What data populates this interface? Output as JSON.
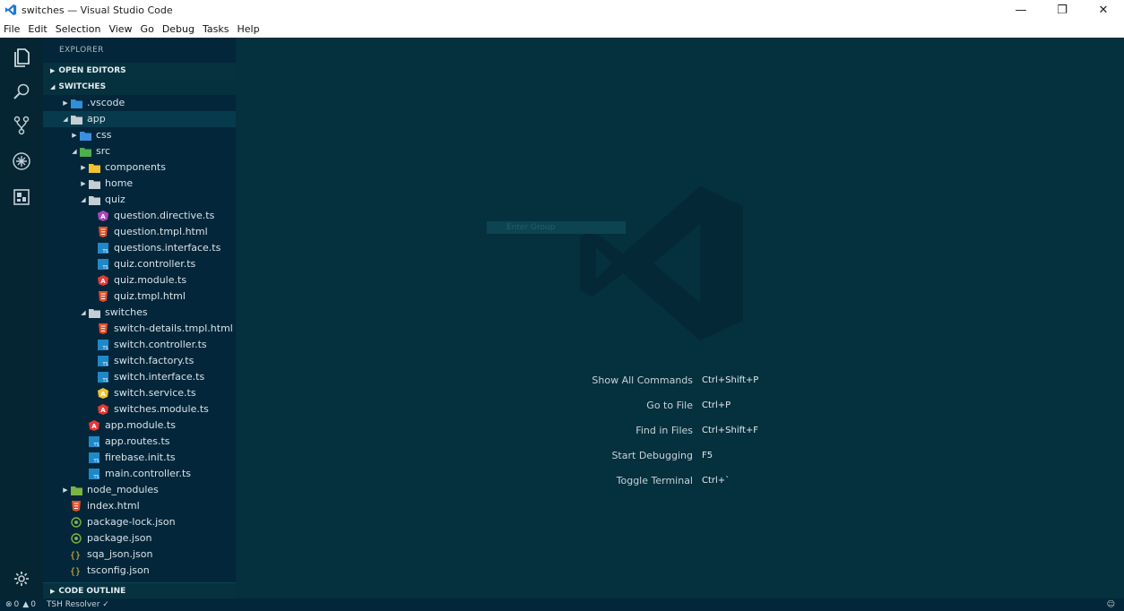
{
  "window": {
    "title": "switches — Visual Studio Code"
  },
  "menu": [
    "File",
    "Edit",
    "Selection",
    "View",
    "Go",
    "Debug",
    "Tasks",
    "Help"
  ],
  "window_controls": {
    "minimize": "—",
    "maximize": "❐",
    "close": "✕"
  },
  "explorer": {
    "title": "EXPLORER",
    "open_editors": "OPEN EDITORS",
    "folder": "SWITCHES",
    "code_outline": "CODE OUTLINE",
    "tree": [
      {
        "label": ".vscode",
        "depth": 1,
        "type": "folder",
        "arrow": "▶",
        "icon": "vscode-folder-icon",
        "color": "#2f8fd8"
      },
      {
        "label": "app",
        "depth": 1,
        "type": "folder",
        "arrow": "◢",
        "icon": "folder-open-icon",
        "color": "#c5ced3",
        "selected": true
      },
      {
        "label": "css",
        "depth": 2,
        "type": "folder",
        "arrow": "▶",
        "icon": "css-folder-icon",
        "color": "#3b8fe0"
      },
      {
        "label": "src",
        "depth": 2,
        "type": "folder",
        "arrow": "◢",
        "icon": "src-folder-icon",
        "color": "#4caf50"
      },
      {
        "label": "components",
        "depth": 3,
        "type": "folder",
        "arrow": "▶",
        "icon": "components-folder-icon",
        "color": "#f2c230"
      },
      {
        "label": "home",
        "depth": 3,
        "type": "folder",
        "arrow": "▶",
        "icon": "folder-icon",
        "color": "#c5ced3"
      },
      {
        "label": "quiz",
        "depth": 3,
        "type": "folder",
        "arrow": "◢",
        "icon": "folder-open-icon",
        "color": "#c5ced3"
      },
      {
        "label": "question.directive.ts",
        "depth": 4,
        "type": "file",
        "icon": "angular-directive-icon",
        "color": "#ab47bc"
      },
      {
        "label": "question.tmpl.html",
        "depth": 4,
        "type": "file",
        "icon": "html-icon",
        "color": "#e44d26"
      },
      {
        "label": "questions.interface.ts",
        "depth": 4,
        "type": "file",
        "icon": "typescript-icon",
        "color": "#1e88c9"
      },
      {
        "label": "quiz.controller.ts",
        "depth": 4,
        "type": "file",
        "icon": "typescript-icon",
        "color": "#1e88c9"
      },
      {
        "label": "quiz.module.ts",
        "depth": 4,
        "type": "file",
        "icon": "angular-icon",
        "color": "#e53935"
      },
      {
        "label": "quiz.tmpl.html",
        "depth": 4,
        "type": "file",
        "icon": "html-icon",
        "color": "#e44d26"
      },
      {
        "label": "switches",
        "depth": 3,
        "type": "folder",
        "arrow": "◢",
        "icon": "folder-open-icon",
        "color": "#c5ced3"
      },
      {
        "label": "switch-details.tmpl.html",
        "depth": 4,
        "type": "file",
        "icon": "html-icon",
        "color": "#e44d26"
      },
      {
        "label": "switch.controller.ts",
        "depth": 4,
        "type": "file",
        "icon": "typescript-icon",
        "color": "#1e88c9"
      },
      {
        "label": "switch.factory.ts",
        "depth": 4,
        "type": "file",
        "icon": "typescript-icon",
        "color": "#1e88c9"
      },
      {
        "label": "switch.interface.ts",
        "depth": 4,
        "type": "file",
        "icon": "typescript-icon",
        "color": "#1e88c9"
      },
      {
        "label": "switch.service.ts",
        "depth": 4,
        "type": "file",
        "icon": "angular-service-icon",
        "color": "#f2c230"
      },
      {
        "label": "switches.module.ts",
        "depth": 4,
        "type": "file",
        "icon": "angular-icon",
        "color": "#e53935"
      },
      {
        "label": "app.module.ts",
        "depth": 3,
        "type": "file",
        "icon": "angular-icon",
        "color": "#e53935"
      },
      {
        "label": "app.routes.ts",
        "depth": 3,
        "type": "file",
        "icon": "typescript-icon",
        "color": "#1e88c9"
      },
      {
        "label": "firebase.init.ts",
        "depth": 3,
        "type": "file",
        "icon": "typescript-icon",
        "color": "#1e88c9"
      },
      {
        "label": "main.controller.ts",
        "depth": 3,
        "type": "file",
        "icon": "typescript-icon",
        "color": "#1e88c9"
      },
      {
        "label": "node_modules",
        "depth": 1,
        "type": "folder",
        "arrow": "▶",
        "icon": "node-folder-icon",
        "color": "#7cb342"
      },
      {
        "label": "index.html",
        "depth": 1,
        "type": "file",
        "icon": "html-icon",
        "color": "#e44d26"
      },
      {
        "label": "package-lock.json",
        "depth": 1,
        "type": "file",
        "icon": "nodejs-icon",
        "color": "#7cb342"
      },
      {
        "label": "package.json",
        "depth": 1,
        "type": "file",
        "icon": "nodejs-icon",
        "color": "#7cb342"
      },
      {
        "label": "sqa_json.json",
        "depth": 1,
        "type": "file",
        "icon": "json-icon",
        "color": "#f2c230"
      },
      {
        "label": "tsconfig.json",
        "depth": 1,
        "type": "file",
        "icon": "json-icon",
        "color": "#f2c230"
      }
    ]
  },
  "editor": {
    "hint_text": "Enter Group",
    "shortcuts": [
      {
        "label": "Show All Commands",
        "key": "Ctrl+Shift+P"
      },
      {
        "label": "Go to File",
        "key": "Ctrl+P"
      },
      {
        "label": "Find in Files",
        "key": "Ctrl+Shift+F"
      },
      {
        "label": "Start Debugging",
        "key": "F5"
      },
      {
        "label": "Toggle Terminal",
        "key": "Ctrl+`"
      }
    ]
  },
  "statusbar": {
    "errors": "0",
    "warnings": "0",
    "item": "TSH Resolver ✓"
  },
  "colors": {
    "editor_bg": "#05303e",
    "sidebar_bg": "#04263a",
    "activity_bg": "#042531"
  }
}
